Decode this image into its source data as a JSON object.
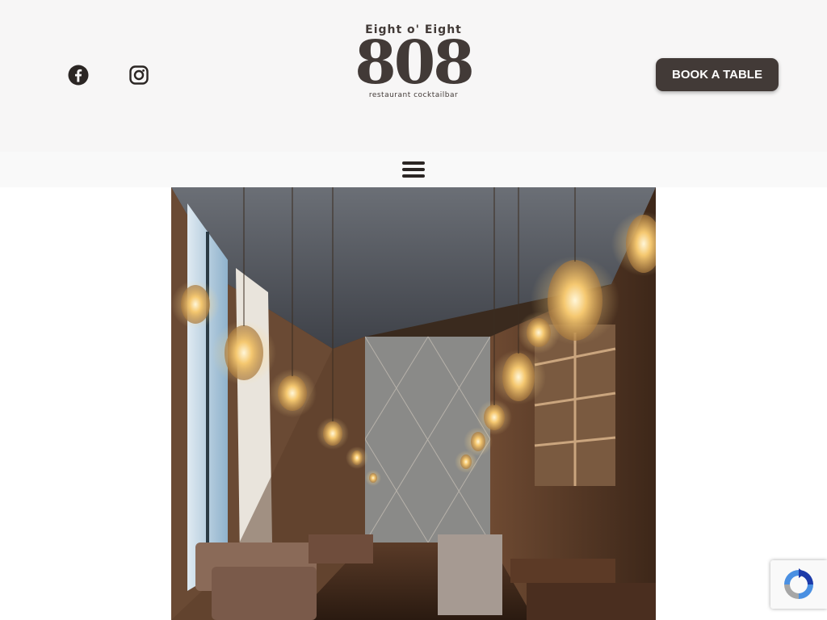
{
  "header": {
    "social": [
      {
        "name": "facebook-icon"
      },
      {
        "name": "instagram-icon"
      }
    ],
    "logo": {
      "top_text": "Eight o' Eight",
      "number": "808",
      "sub_text": "restaurant cocktailbar"
    },
    "book_button": "BOOK A TABLE"
  },
  "nav": {
    "menu_icon": "hamburger-menu-icon"
  },
  "hero": {
    "image": "restaurant-interior-photo"
  },
  "recaptcha": {
    "icon": "recaptcha-icon"
  },
  "colors": {
    "brand_dark": "#423a37",
    "header_bg": "#f7f6f6",
    "nav_bg": "#f9f9f9"
  }
}
